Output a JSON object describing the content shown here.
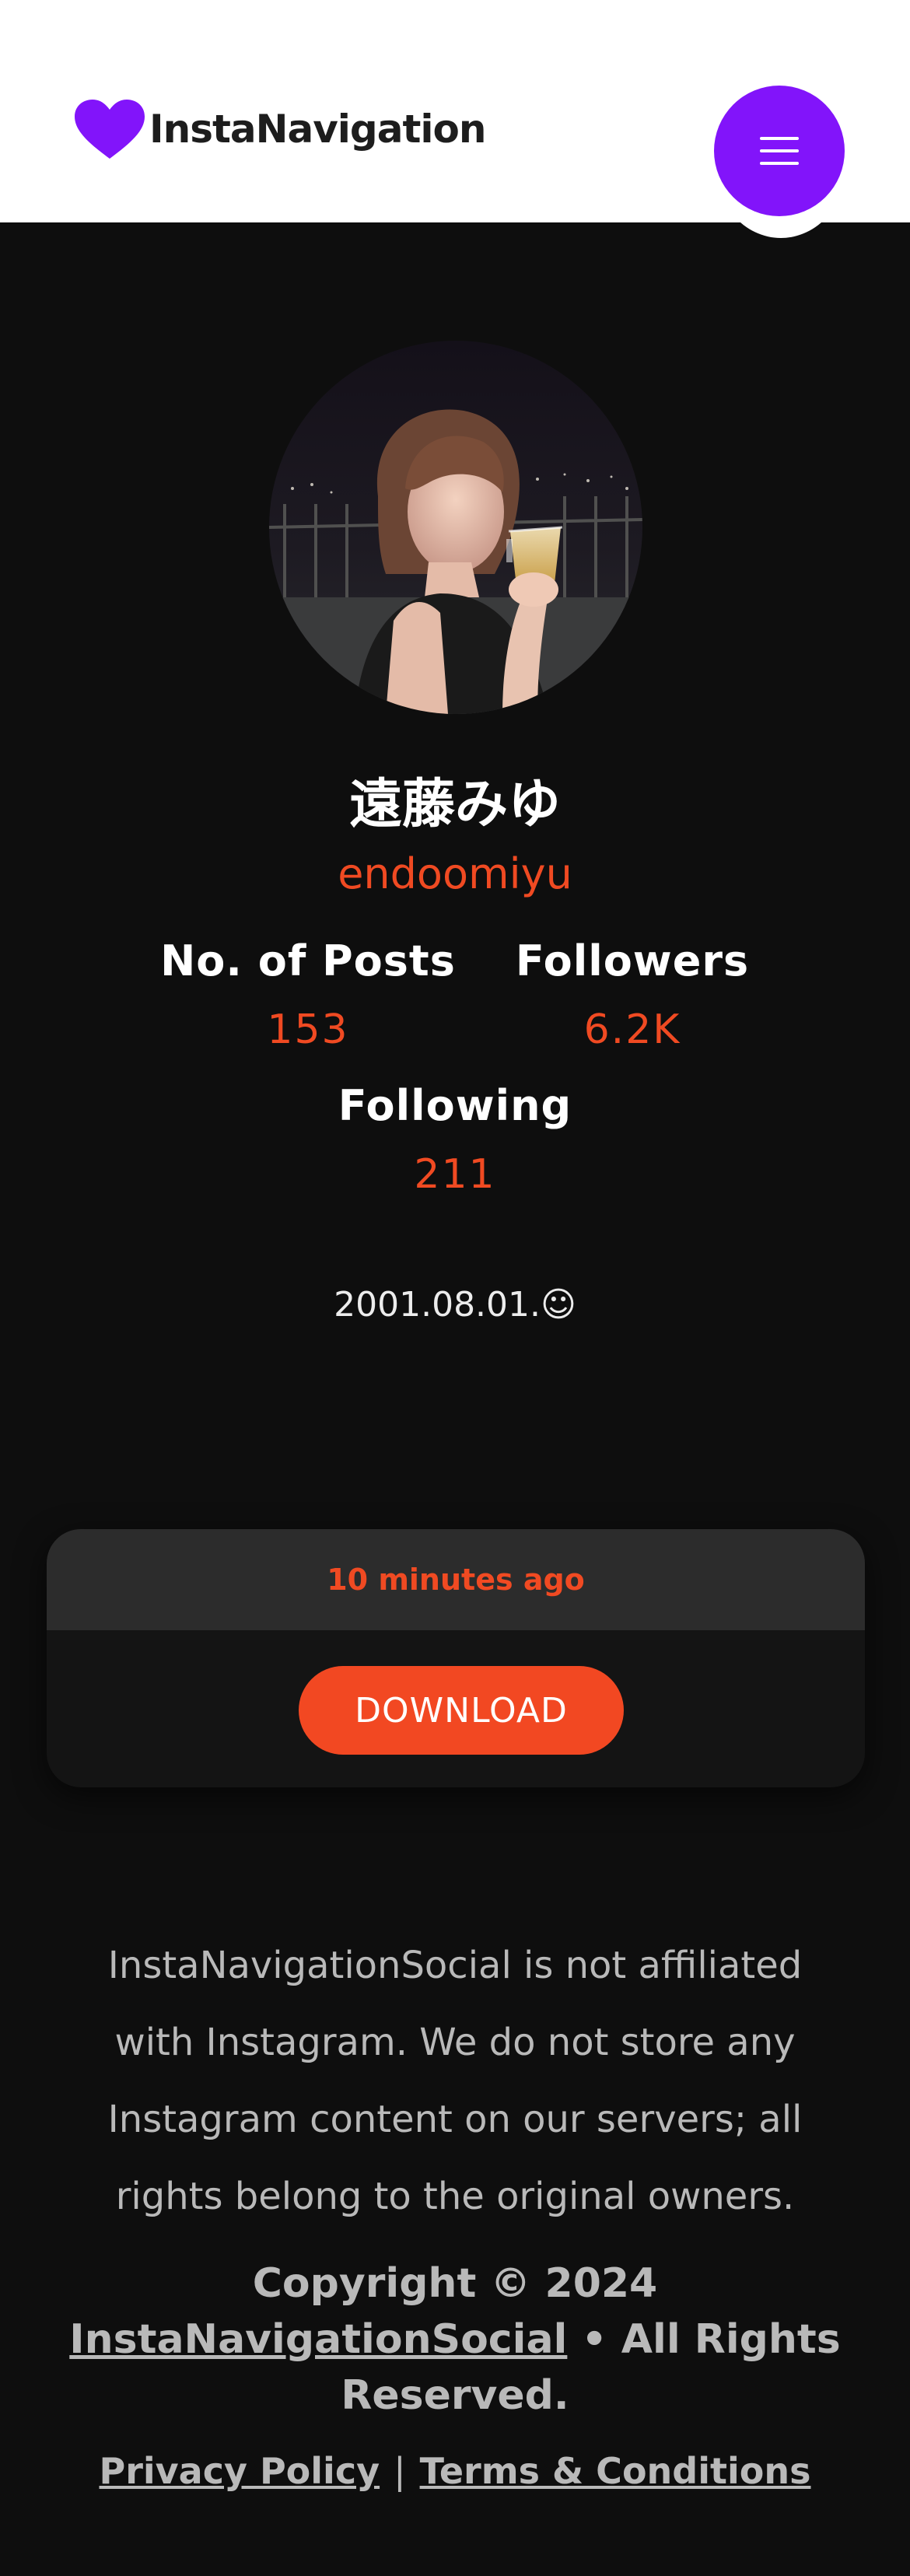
{
  "header": {
    "logo_text": "InstaNavigation",
    "brand_color": "#8214fa"
  },
  "profile": {
    "display_name": "遠藤みゆ",
    "username": "endoomiyu",
    "stats": {
      "posts_label": "No. of Posts",
      "posts_value": "153",
      "followers_label": "Followers",
      "followers_value": "6.2K",
      "following_label": "Following",
      "following_value": "211"
    },
    "bio": "2001.08.01.☺"
  },
  "post_card": {
    "timestamp": "10 minutes ago",
    "download_label": "DOWNLOAD"
  },
  "footer": {
    "disclaimer": "InstaNavigationSocial is not affiliated with Instagram. We do not store any Instagram content on our servers; all rights belong to the original owners.",
    "copyright_prefix": "Copyright © 2024",
    "copyright_link": "InstaNavigationSocial",
    "copyright_suffix": " • All Rights Reserved.",
    "privacy_label": "Privacy Policy",
    "separator": "|",
    "terms_label": "Terms & Conditions"
  },
  "colors": {
    "accent": "#f04a22",
    "background": "#0e0e0e",
    "card_header": "#2c2c2c"
  }
}
